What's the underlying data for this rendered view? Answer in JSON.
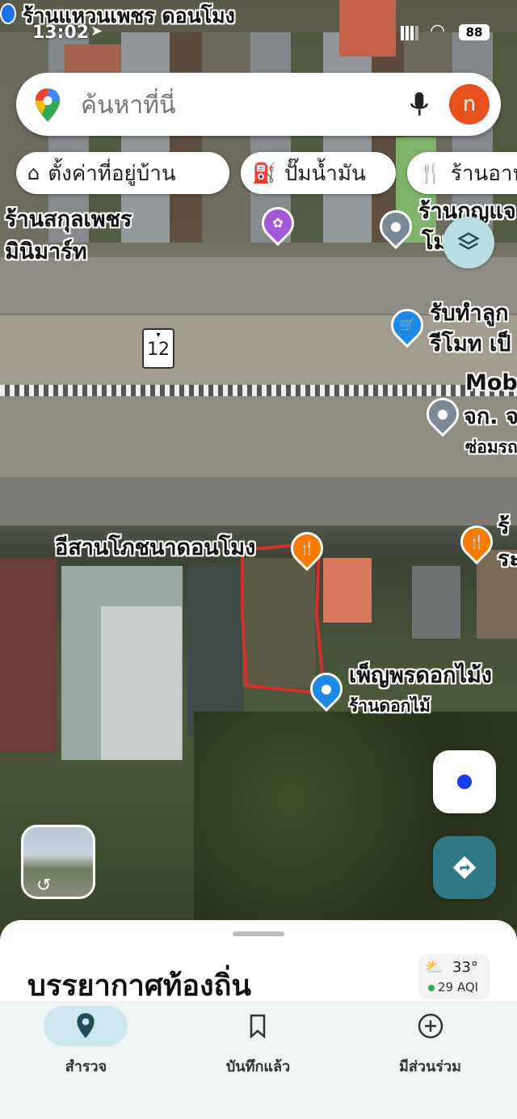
{
  "status_bar": {
    "time": "13:02",
    "battery": "88"
  },
  "top_place_label": "ร้านแหวนเพชร ดอนโมง",
  "search": {
    "placeholder": "ค้นหาที่นี่",
    "avatar_letter": "n"
  },
  "chips": [
    {
      "label": "ตั้งค่าที่อยู่บ้าน",
      "icon": "home-icon"
    },
    {
      "label": "ปั๊มน้ำมัน",
      "icon": "gas-station-icon"
    },
    {
      "label": "ร้านอาหาร",
      "icon": "restaurant-icon"
    }
  ],
  "map_labels": {
    "sakul_line1": "ร้านสกุลเพชร",
    "sakul_line2": "มินิมาร์ท",
    "top_right_line1": "ร้านกุญแจ",
    "top_right_line2": "โมงออ",
    "remote_line1": "รับทำลูก",
    "remote_line2": "รีโมท เป็",
    "road_number": "12",
    "mob_line1": "Mob",
    "mob_line2": "จก. จ",
    "mob_line3": "ซ่อมรถ",
    "isan_restaurant": "อีสานโภชนาดอนโมง",
    "right_edge_1": "ร้",
    "right_edge_2": "ระ",
    "flower_line1": "เพ็ญพรดอกไม้ง",
    "flower_line2": "ร้านดอกไม้"
  },
  "sheet": {
    "title": "บรรยากาศท้องถิ่น",
    "temperature": "33°",
    "aqi": "29 AQI"
  },
  "nav": [
    {
      "label": "สำรวจ",
      "icon": "explore-pin-icon",
      "active": true
    },
    {
      "label": "บันทึกแล้ว",
      "icon": "bookmark-icon",
      "active": false
    },
    {
      "label": "มีส่วนร่วม",
      "icon": "add-circle-icon",
      "active": false
    }
  ],
  "colors": {
    "accent": "#1a73e8",
    "nav_active_bg": "#cde7ef",
    "restaurant_pin": "#f57c00",
    "shopping_pin": "#1e88e5",
    "generic_pin": "#7a8a95",
    "art_pin": "#a259d9",
    "directions_fab": "#2f7a86",
    "drawn_outline": "#d32f2f"
  }
}
